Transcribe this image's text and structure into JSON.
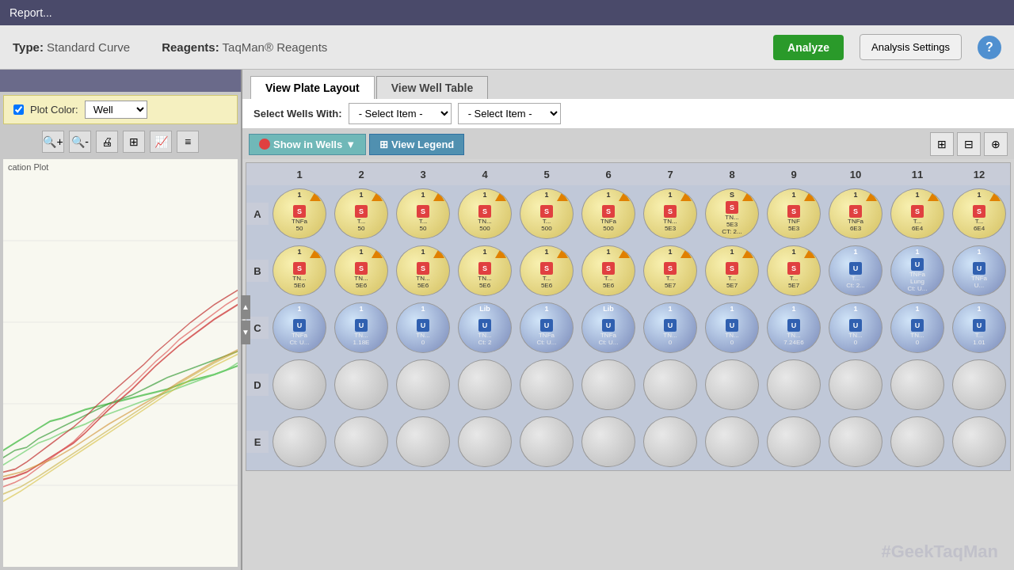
{
  "titleBar": {
    "text": "Report..."
  },
  "header": {
    "typeLabel": "Type:",
    "typeValue": "Standard Curve",
    "reagentsLabel": "Reagents:",
    "reagentsValue": "TaqMan® Reagents",
    "analyzeBtn": "Analyze",
    "settingsBtn": "Analysis Settings",
    "helpBtn": "?"
  },
  "leftPanel": {
    "plotColorLabel": "Plot Color:",
    "plotColorValue": "Well",
    "chartLabel": "cation Plot",
    "tools": [
      "+",
      "-",
      "🖨",
      "📊",
      "📈",
      "≡"
    ]
  },
  "rightPanel": {
    "tabs": [
      {
        "label": "View Plate Layout",
        "active": true
      },
      {
        "label": "View Well Table",
        "active": false
      }
    ],
    "selectWellsWith": "Select Wells With:",
    "dropdown1": "- Select Item -",
    "dropdown2": "- Select Item -",
    "showInWells": "Show in Wells",
    "viewLegend": "View Legend"
  },
  "plate": {
    "colHeaders": [
      "1",
      "2",
      "3",
      "4",
      "5",
      "6",
      "7",
      "8",
      "9",
      "10",
      "11",
      "12"
    ],
    "rowHeaders": [
      "A",
      "B",
      "C",
      "D",
      "E"
    ],
    "wells": {
      "A": [
        {
          "type": "yellow",
          "badge": "1",
          "icon": "S",
          "text": "TNFa\n50"
        },
        {
          "type": "yellow",
          "badge": "1",
          "icon": "S",
          "text": "T...\n50"
        },
        {
          "type": "yellow",
          "badge": "1",
          "icon": "S",
          "text": "T...\n50"
        },
        {
          "type": "yellow",
          "badge": "1",
          "icon": "S",
          "text": "TN...\n500"
        },
        {
          "type": "yellow",
          "badge": "1",
          "icon": "S",
          "text": "T...\n500"
        },
        {
          "type": "yellow",
          "badge": "1",
          "icon": "S",
          "text": "TNFa\n500"
        },
        {
          "type": "yellow",
          "badge": "1",
          "icon": "S",
          "text": "TN...\n5E3"
        },
        {
          "type": "yellow",
          "badge": "S",
          "icon": "S",
          "text": "TN...\n5E3\nCT: 2..."
        },
        {
          "type": "yellow",
          "badge": "1",
          "icon": "S",
          "text": "TNF\n5E3"
        },
        {
          "type": "yellow",
          "badge": "1",
          "icon": "S",
          "text": "TNFa\n6E3"
        },
        {
          "type": "yellow",
          "badge": "1",
          "icon": "S",
          "text": "T...\n6E4"
        },
        {
          "type": "yellow",
          "badge": "1",
          "icon": "S",
          "text": "T...\n6E4"
        }
      ],
      "B": [
        {
          "type": "yellow",
          "badge": "1",
          "icon": "S",
          "text": "TN...\n5E6"
        },
        {
          "type": "yellow",
          "badge": "1",
          "icon": "S",
          "text": "TN...\n5E6"
        },
        {
          "type": "yellow",
          "badge": "1",
          "icon": "S",
          "text": "TN...\n5E6"
        },
        {
          "type": "yellow",
          "badge": "1",
          "icon": "S",
          "text": "TN...\n5E6"
        },
        {
          "type": "yellow",
          "badge": "1",
          "icon": "S",
          "text": "T...\n5E6"
        },
        {
          "type": "yellow",
          "badge": "1",
          "icon": "S",
          "text": "T...\n5E6"
        },
        {
          "type": "yellow",
          "badge": "1",
          "icon": "S",
          "text": "T...\n5E7"
        },
        {
          "type": "yellow",
          "badge": "1",
          "icon": "S",
          "text": "T...\n5E7"
        },
        {
          "type": "yellow",
          "badge": "1",
          "icon": "S",
          "text": "T...\n5E7"
        },
        {
          "type": "blue",
          "badge": "1",
          "icon": "U",
          "text": "T...\nCt: 2..."
        },
        {
          "type": "blue",
          "badge": "1",
          "icon": "U",
          "text": "TNFa\nLung\nCt: U..."
        },
        {
          "type": "blue",
          "badge": "1",
          "icon": "U",
          "text": "TNFa\nU..."
        }
      ],
      "C": [
        {
          "type": "blue",
          "badge": "1",
          "icon": "U",
          "text": "TNFa\nCt: U..."
        },
        {
          "type": "blue",
          "badge": "1",
          "icon": "U",
          "text": "TN...\n1.18E"
        },
        {
          "type": "blue",
          "badge": "1",
          "icon": "U",
          "text": "TN...\n0"
        },
        {
          "type": "blue",
          "badge": "Lib",
          "icon": "U",
          "text": "TN...\nCt: 2"
        },
        {
          "type": "blue",
          "badge": "1",
          "icon": "U",
          "text": "TNFa\nCt: U..."
        },
        {
          "type": "blue",
          "badge": "Lib",
          "icon": "U",
          "text": "TNFa\nCt: U..."
        },
        {
          "type": "blue",
          "badge": "1",
          "icon": "U",
          "text": "TN...\n0"
        },
        {
          "type": "blue",
          "badge": "1",
          "icon": "U",
          "text": "TN...\n0"
        },
        {
          "type": "blue",
          "badge": "1",
          "icon": "U",
          "text": "TN...\n7.24E6"
        },
        {
          "type": "blue",
          "badge": "1",
          "icon": "U",
          "text": "TN...\n0"
        },
        {
          "type": "blue",
          "badge": "1",
          "icon": "U",
          "text": "TN...\n0"
        },
        {
          "type": "blue",
          "badge": "1",
          "icon": "U",
          "text": "T...\n1.01"
        }
      ],
      "D": [
        {
          "type": "empty"
        },
        {
          "type": "empty"
        },
        {
          "type": "empty"
        },
        {
          "type": "empty"
        },
        {
          "type": "empty"
        },
        {
          "type": "empty"
        },
        {
          "type": "empty"
        },
        {
          "type": "empty"
        },
        {
          "type": "empty"
        },
        {
          "type": "empty"
        },
        {
          "type": "empty"
        },
        {
          "type": "empty"
        }
      ],
      "E": [
        {
          "type": "empty"
        },
        {
          "type": "empty"
        },
        {
          "type": "empty"
        },
        {
          "type": "empty"
        },
        {
          "type": "empty"
        },
        {
          "type": "empty"
        },
        {
          "type": "empty"
        },
        {
          "type": "empty"
        },
        {
          "type": "empty"
        },
        {
          "type": "empty"
        },
        {
          "type": "empty"
        },
        {
          "type": "empty"
        }
      ]
    }
  }
}
